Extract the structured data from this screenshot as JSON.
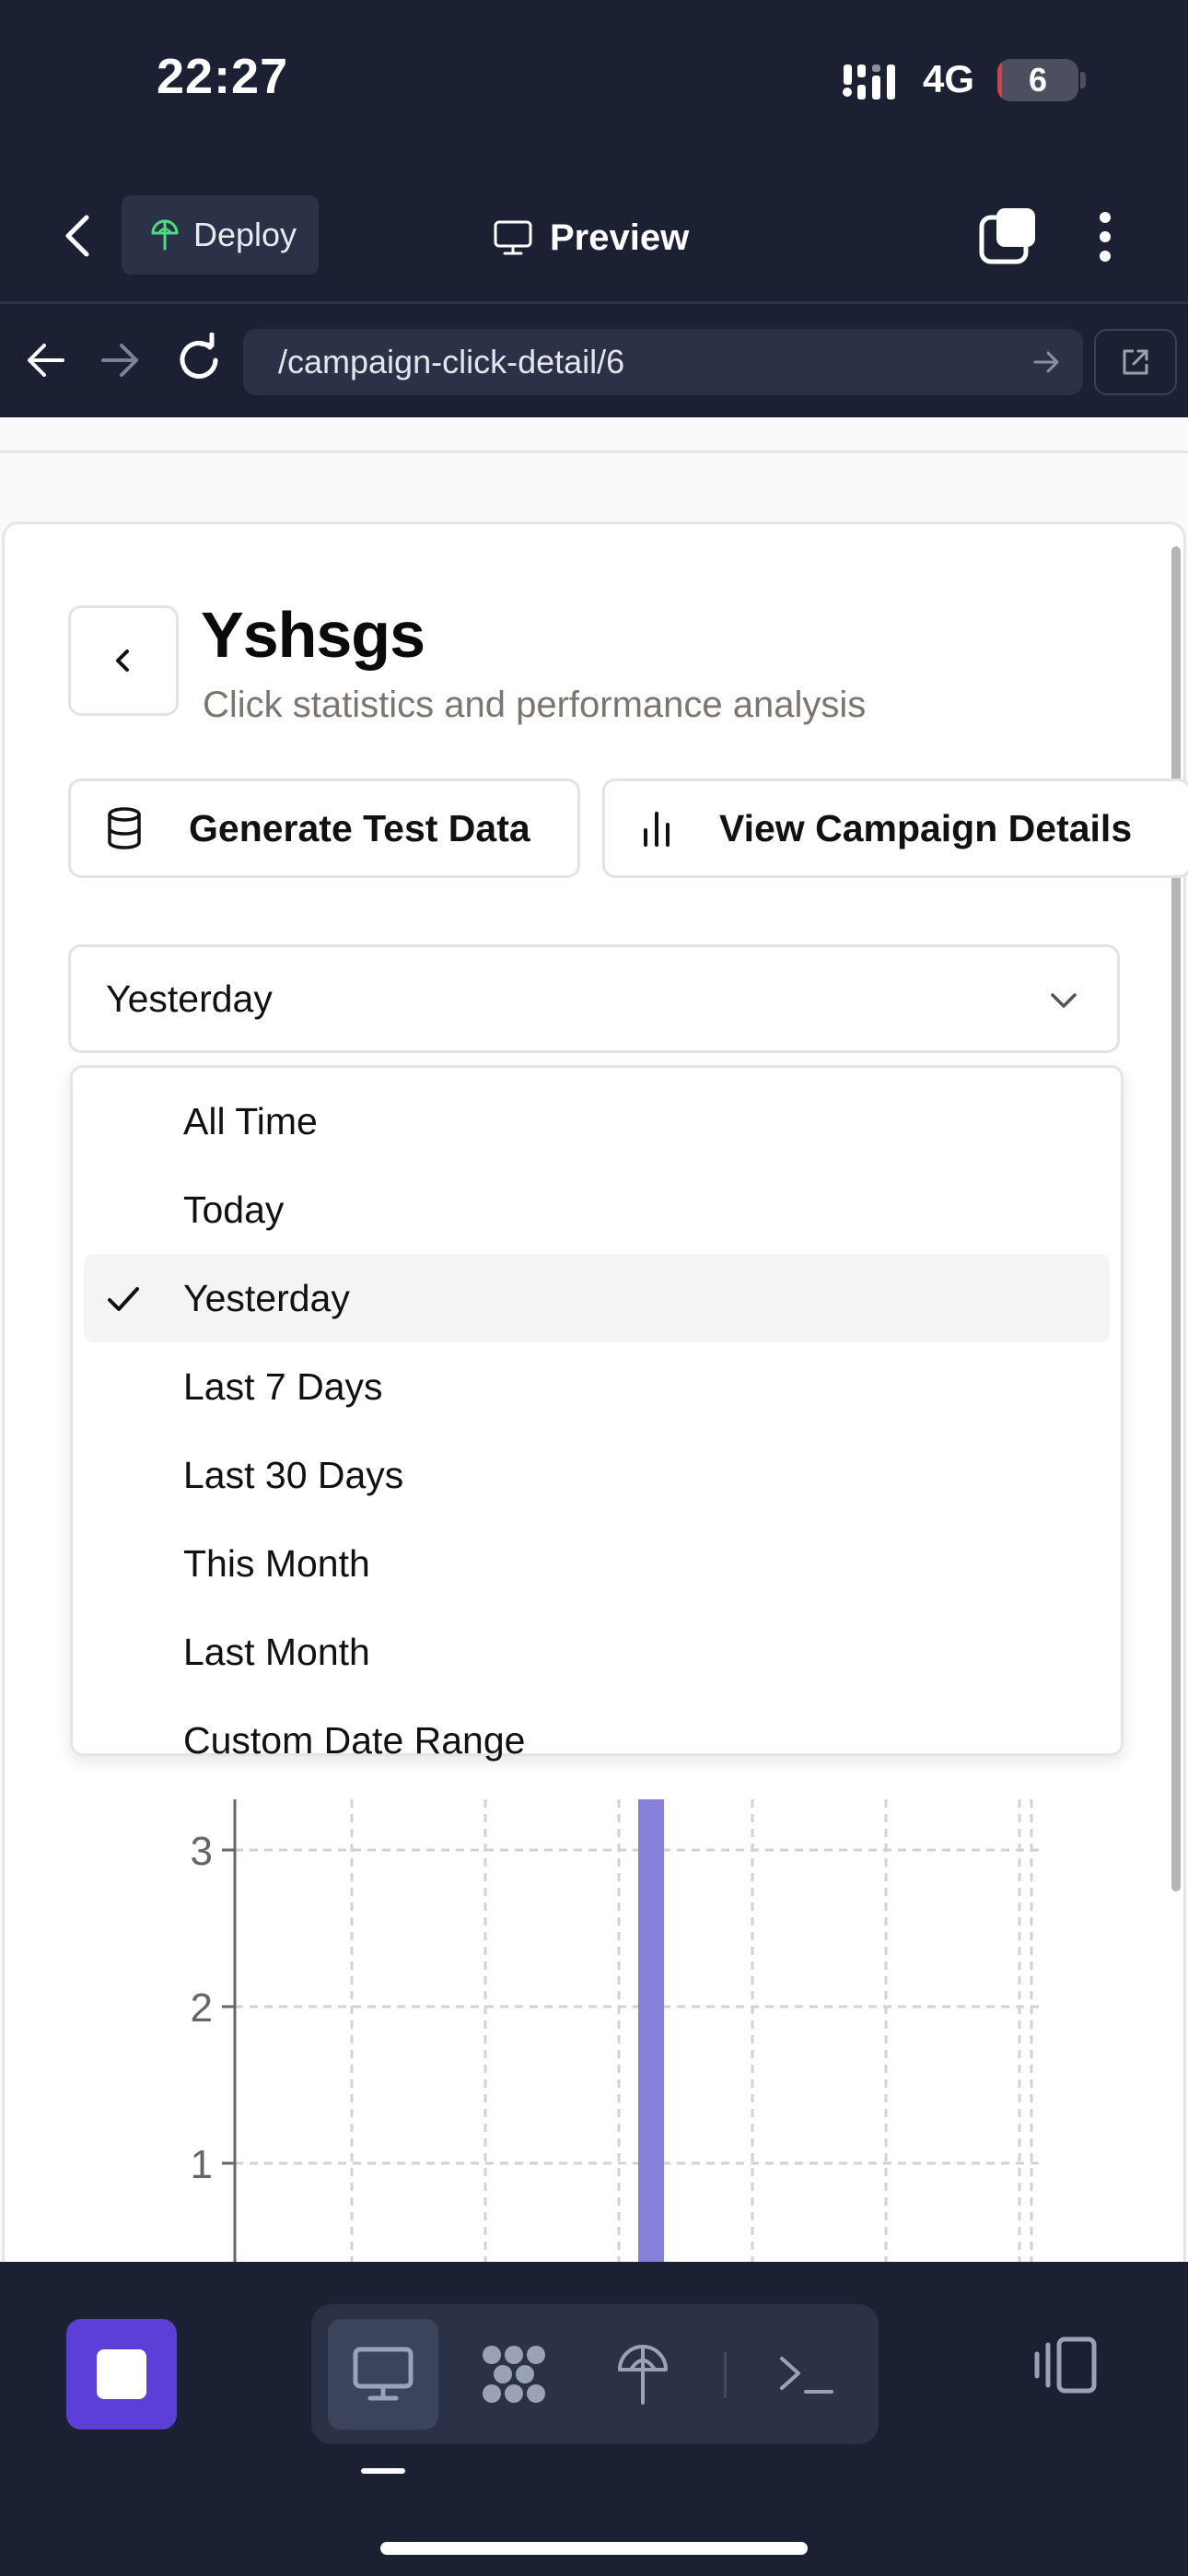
{
  "status_bar": {
    "time": "22:27",
    "network": "4G",
    "battery_level": "6",
    "battery_fraction": 0.06
  },
  "app_toolbar": {
    "deploy_label": "Deploy",
    "preview_label": "Preview"
  },
  "browser": {
    "url": "/campaign-click-detail/6"
  },
  "page": {
    "title": "Yshsgs",
    "subtitle": "Click statistics and performance analysis",
    "generate_button": "Generate Test Data",
    "view_details_button": "View Campaign Details"
  },
  "date_filter": {
    "selected": "Yesterday",
    "options": [
      "All Time",
      "Today",
      "Yesterday",
      "Last 7 Days",
      "Last 30 Days",
      "This Month",
      "Last Month",
      "Custom Date Range"
    ]
  },
  "colors": {
    "background_dark": "#1b2033",
    "accent_purple": "#5b3fd6",
    "bar_color": "#8780d9"
  },
  "chart_data": {
    "type": "bar",
    "y_ticks": [
      "1",
      "2",
      "3"
    ],
    "ylim": [
      0,
      4
    ],
    "grid": true,
    "visible_bar_value_at_least": 3
  },
  "bottom_bar": {
    "icons": [
      "stop-icon",
      "desktop-icon",
      "components-icon",
      "deploy-icon",
      "terminal-icon",
      "panel-toggle-icon"
    ]
  }
}
